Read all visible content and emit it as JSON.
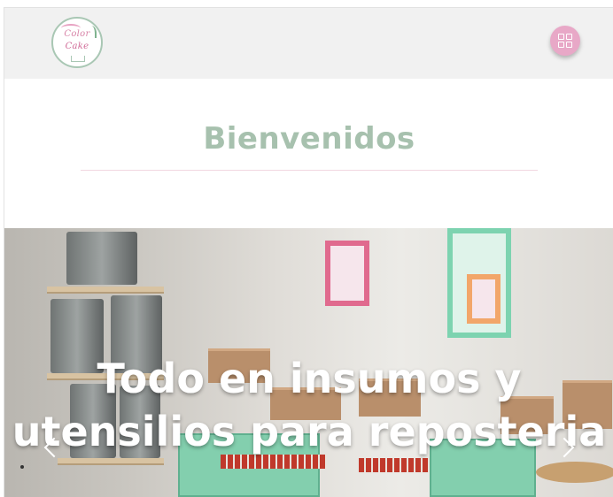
{
  "header": {
    "logo": {
      "line1": "Color",
      "line2": "Cake"
    },
    "menu_icon": "grid-menu-icon"
  },
  "welcome": {
    "title": "Bienvenidos"
  },
  "carousel": {
    "caption": "Todo en insumos y utensilios para reposteria",
    "prev_icon": "chevron-left-icon",
    "next_icon": "chevron-right-icon"
  },
  "colors": {
    "header_bg": "#f1f1f1",
    "title": "#a7c1ae",
    "accent_pink": "#e8a8c7",
    "divider": "#f1d6e0"
  }
}
